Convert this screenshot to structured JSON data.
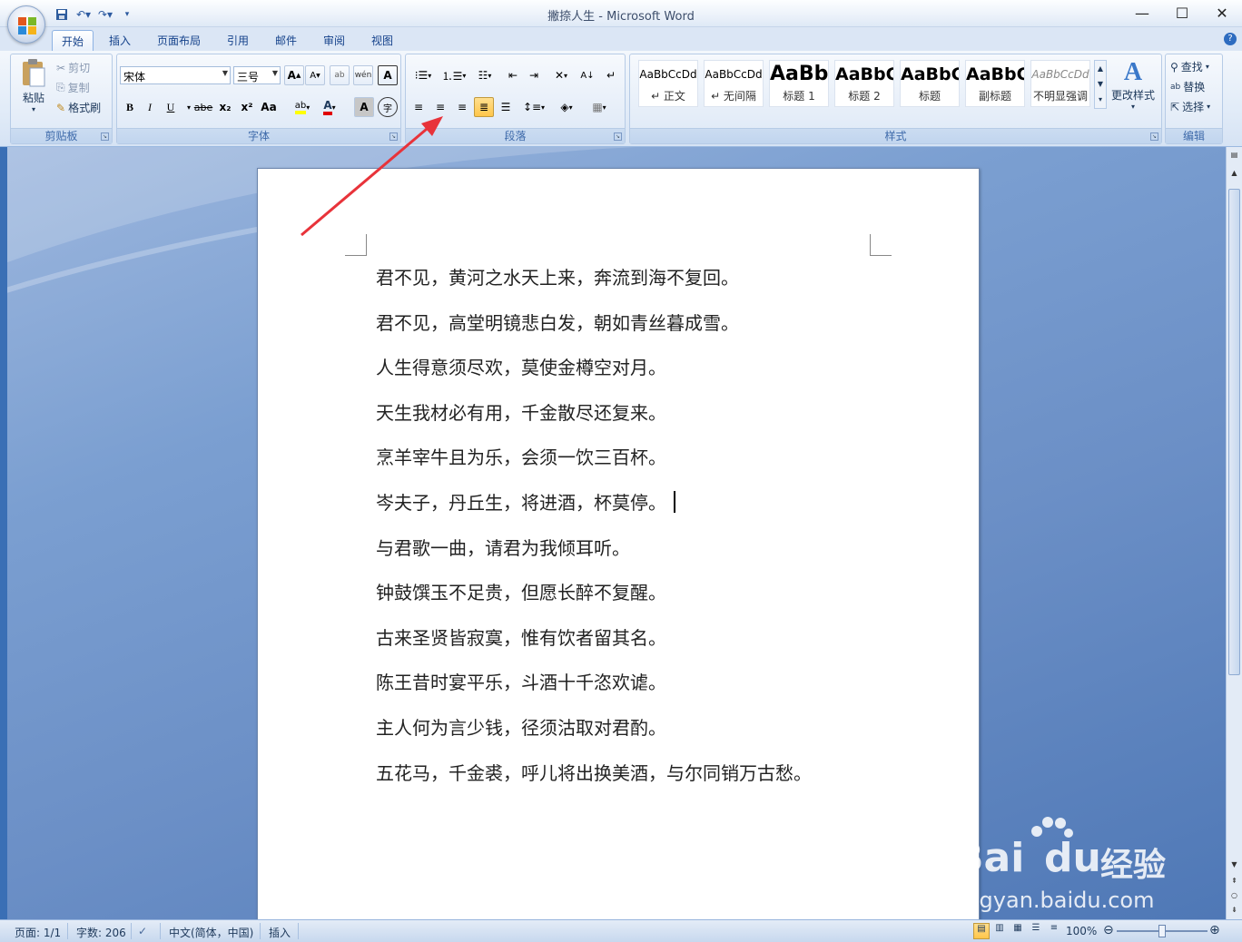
{
  "window": {
    "title": "撇捺人生 - Microsoft Word",
    "controls": {
      "minimize": "—",
      "maximize": "☐",
      "close": "✕"
    }
  },
  "tabs": [
    "开始",
    "插入",
    "页面布局",
    "引用",
    "邮件",
    "审阅",
    "视图"
  ],
  "ribbon": {
    "clipboard": {
      "paste": "粘贴",
      "cut": "剪切",
      "copy": "复制",
      "format_painter": "格式刷",
      "label": "剪贴板"
    },
    "font": {
      "font_name": "宋体",
      "font_size": "三号",
      "label": "字体",
      "bold": "B",
      "italic": "I",
      "underline": "U",
      "strike": "abe",
      "subscript": "x₂",
      "superscript": "x²",
      "change_case": "Aa",
      "grow": "A",
      "shrink": "A",
      "clear": "ab",
      "phonetic": "wén",
      "border_char": "A",
      "shade_char": "A",
      "enclose": "字",
      "font_color": "A",
      "highlight": "ab"
    },
    "paragraph": {
      "label": "段落"
    },
    "styles": {
      "label": "样式",
      "items": [
        {
          "sample": "AaBbCcDd",
          "name": "↵ 正文"
        },
        {
          "sample": "AaBbCcDd",
          "name": "↵ 无间隔"
        },
        {
          "sample": "AaBb",
          "name": "标题 1"
        },
        {
          "sample": "AaBbC",
          "name": "标题 2"
        },
        {
          "sample": "AaBbC",
          "name": "标题"
        },
        {
          "sample": "AaBbC",
          "name": "副标题"
        },
        {
          "sample": "AaBbCcDd",
          "name": "不明显强调"
        }
      ],
      "change_styles": "更改样式"
    },
    "editing": {
      "find": "查找",
      "replace": "替换",
      "select": "选择",
      "label": "编辑"
    }
  },
  "document": {
    "lines": [
      "君不见，黄河之水天上来，奔流到海不复回。",
      "君不见，高堂明镜悲白发，朝如青丝暮成雪。",
      "人生得意须尽欢，莫使金樽空对月。",
      "天生我材必有用，千金散尽还复来。",
      "烹羊宰牛且为乐，会须一饮三百杯。",
      "岑夫子，丹丘生，将进酒，杯莫停。",
      "与君歌一曲，请君为我倾耳听。",
      "钟鼓馔玉不足贵，但愿长醉不复醒。",
      "古来圣贤皆寂寞，惟有饮者留其名。",
      "陈王昔时宴平乐，斗酒十千恣欢谑。",
      "主人何为言少钱，径须沽取对君酌。",
      "五花马，千金裘，呼儿将出换美酒，与尔同销万古愁。"
    ]
  },
  "statusbar": {
    "page": "页面: 1/1",
    "words": "字数: 206",
    "language": "中文(简体，中国)",
    "mode": "插入",
    "zoom": "100%",
    "zoom_level": 1.0
  },
  "watermark": {
    "brand": "Bai",
    "brand2": "du",
    "cn": "经验",
    "url": "jingyan.baidu.com"
  },
  "colors": {
    "accent": "#15428b",
    "ribbon": "#dbe6f5",
    "annotation": "#e8333a"
  }
}
